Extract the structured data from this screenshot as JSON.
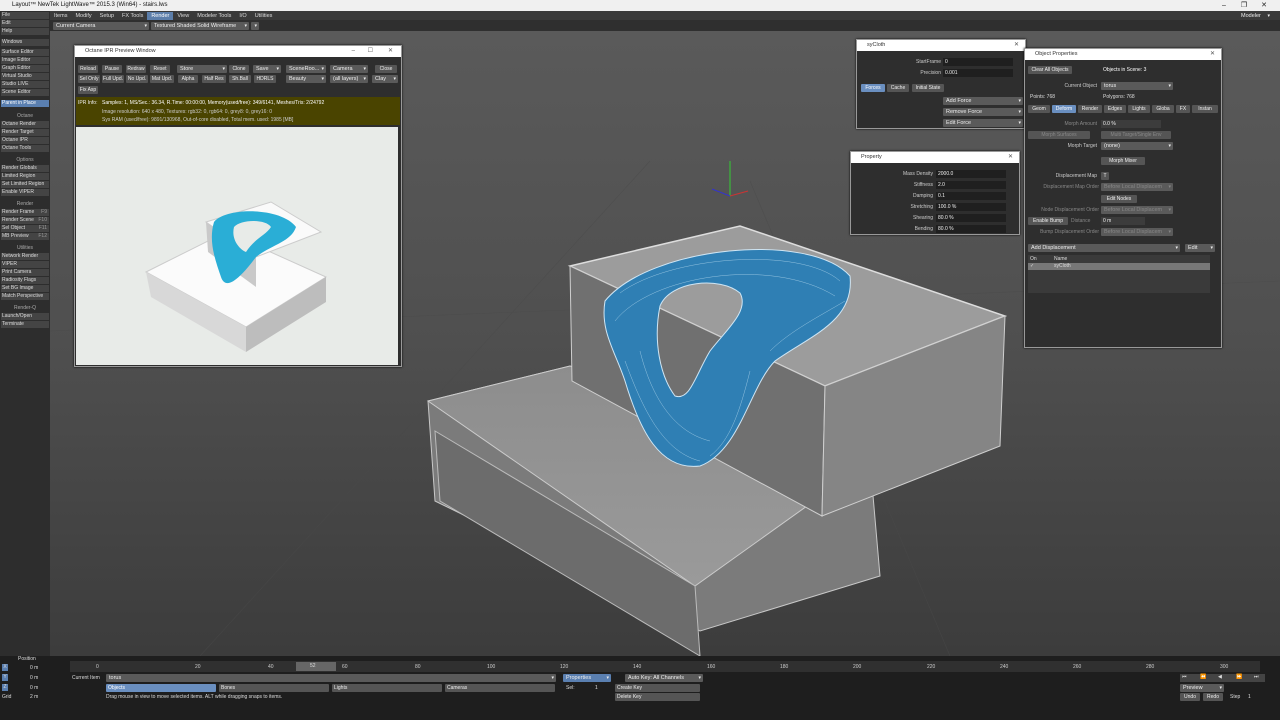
{
  "app": {
    "title": "Layout™ NewTek LightWave™ 2015.3 (Win64) - stairs.lws",
    "modeler_label": "Modeler"
  },
  "menu": [
    "Items",
    "Modify",
    "Setup",
    "FX Tools",
    "Render",
    "View",
    "Modeler Tools",
    "I/O",
    "Utilities"
  ],
  "left_menu": [
    "File",
    "Edit",
    "Help"
  ],
  "toolbar": {
    "camera": "Current Camera",
    "viewmode": "Textured Shaded Solid Wireframe"
  },
  "sidebar": {
    "windows": "Windows",
    "items1": [
      "Surface Editor",
      "Image Editor",
      "Graph Editor",
      "Virtual Studio",
      "Studio LIVE",
      "Scene Editor"
    ],
    "parent": "Parent in Place",
    "octane_h": "Octane",
    "octane": [
      "Octane Render",
      "Render Target",
      "Octane IPR",
      "Octane Tools"
    ],
    "options_h": "Options",
    "options": [
      "Render Globals",
      "Limited Region",
      "Set Limited Region",
      "Enable VIPER"
    ],
    "render_h": "Render",
    "render": [
      "Render Frame",
      "Render Scene",
      "Sel Object",
      "MB Preview"
    ],
    "utilities_h": "Utilities",
    "utilities": [
      "Network Render",
      "VIPER",
      "Print Camera",
      "Radiosity Flags",
      "Set BG Image",
      "Match Perspective"
    ],
    "renderq_h": "Render-Q",
    "renderq": [
      "Launch/Open",
      "Terminate"
    ],
    "keys": [
      "F9",
      "F10",
      "F11",
      "F12"
    ]
  },
  "octane": {
    "title": "Octane IPR Preview Window",
    "row1": [
      "Reload",
      "Pause",
      "Redraw",
      "Reset",
      "Store",
      "Clone",
      "Save",
      "SceneRoo...",
      "Camera",
      "Close"
    ],
    "row2": [
      "Sel Only",
      "Full Upd.",
      "No Upd.",
      "Mat Upd.",
      "Alpha",
      "Half Res",
      "Sh.Ball",
      "HDRLS",
      "Beauty",
      "(all layers)",
      "Clay"
    ],
    "fix": "Fix Asp",
    "info_label": "IPR Info:",
    "info1": "Samples: 1, MS/Sec.: 36.34, R.Time: 00:00:00, Memory(used/free): 349/6141, Meshes/Tris: 2/24792",
    "info2": "Image resolution: 640 x 480, Textures: rgb32: 0, rgb64: 0, grey8: 0, grey16: 0",
    "info3": "Sys RAM (used/free): 9891/130968, Out-of-core disabled, Total mem. used: 1985 [MB]"
  },
  "sycloth": {
    "title": "syCloth",
    "startframe_l": "StartFrame",
    "startframe": "0",
    "precision_l": "Precision",
    "precision": "0.001",
    "tabs": [
      "Forces",
      "Cache",
      "Initial State"
    ],
    "add": "Add Force",
    "remove": "Remove Force",
    "edit": "Edit Force"
  },
  "property": {
    "title": "Property",
    "rows": [
      {
        "l": "Mass Density",
        "v": "2000.0"
      },
      {
        "l": "Stiffness",
        "v": "2.0"
      },
      {
        "l": "Damping",
        "v": "0.1"
      },
      {
        "l": "Stretching",
        "v": "100.0 %"
      },
      {
        "l": "Shearing",
        "v": "80.0 %"
      },
      {
        "l": "Bending",
        "v": "80.0 %"
      }
    ]
  },
  "objprops": {
    "title": "Object Properties",
    "clear": "Clear All Objects",
    "count": "Objects in Scene: 3",
    "current_l": "Current Object",
    "current": "torus",
    "points": "Points: 768",
    "polys": "Polygons: 768",
    "tabs": [
      "Geom",
      "Deform",
      "Render",
      "Edges",
      "Lights",
      "Globa",
      "FX",
      "Instan"
    ],
    "morph_amount": "Morph Amount",
    "morph_val": "0.0 %",
    "morph_surfaces": "Morph Surfaces",
    "multi": "Multi Target/Single Env",
    "morph_target_l": "Morph Target",
    "morph_target": "(none)",
    "mixer": "Morph Mixer",
    "disp_map": "Displacement Map",
    "t": "T",
    "disp_order": "Displacement Map Order",
    "before_local": "Before Local Displacem",
    "edit_nodes": "Edit Nodes",
    "node_order": "Node Displacement Order",
    "enable_bump": "Enable Bump",
    "distance": "Distance",
    "distance_v": "0 m",
    "bump_order": "Bump Displacement Order",
    "add_disp": "Add Displacement",
    "edit": "Edit",
    "col_on": "On",
    "col_name": "Name",
    "row_name": "syCloth"
  },
  "timeline": {
    "ticks": [
      "0",
      "20",
      "40",
      "60",
      "80",
      "100",
      "120",
      "140",
      "160",
      "180",
      "200",
      "220",
      "240",
      "260",
      "280",
      "300"
    ],
    "current": "52",
    "position": "Position",
    "axes": [
      "X",
      "Y",
      "Z"
    ],
    "vals": [
      "0 m",
      "0 m",
      "0 m"
    ],
    "grid_l": "Grid",
    "grid": "2 m",
    "current_item_l": "Current Item",
    "current_item": "torus",
    "objects": "Objects",
    "bones": "Bones",
    "lights": "Lights",
    "cameras": "Cameras",
    "properties": "Properties",
    "sel_l": "Sel:",
    "sel": "1",
    "autokey": "Auto Key: All Channels",
    "create_key": "Create Key",
    "delete_key": "Delete Key",
    "preview": "Preview",
    "undo": "Undo",
    "redo": "Redo",
    "step_l": "Step",
    "step": "1",
    "end": "300",
    "status": "Drag mouse in view to move selected items. ALT while dragging snaps to items."
  }
}
